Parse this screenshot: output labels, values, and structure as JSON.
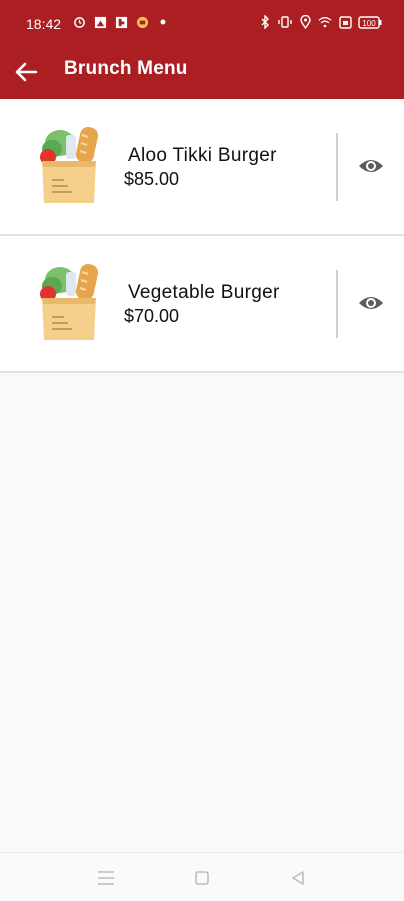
{
  "status_bar": {
    "time": "18:42",
    "left_icons": [
      "sync-icon",
      "image-icon",
      "flipboard-icon",
      "sms-icon",
      "dot-icon"
    ],
    "right_icons": [
      "bluetooth-icon",
      "vibrate-icon",
      "location-icon",
      "wifi-icon",
      "sim-icon",
      "battery-icon"
    ],
    "battery": "100"
  },
  "app_bar": {
    "back_icon": "arrow-left-icon",
    "title": "Brunch Menu"
  },
  "menu_items": [
    {
      "name": "Aloo Tikki Burger",
      "price": "$85.00",
      "image_icon": "grocery-bag-icon",
      "view_icon": "eye-icon"
    },
    {
      "name": "Vegetable Burger",
      "price": "$70.00",
      "image_icon": "grocery-bag-icon",
      "view_icon": "eye-icon"
    }
  ],
  "nav_bar": {
    "buttons": [
      "menu-nav-icon",
      "home-nav-icon",
      "back-nav-icon"
    ]
  },
  "colors": {
    "primary": "#ab1e22",
    "background": "#f9f9f9"
  }
}
